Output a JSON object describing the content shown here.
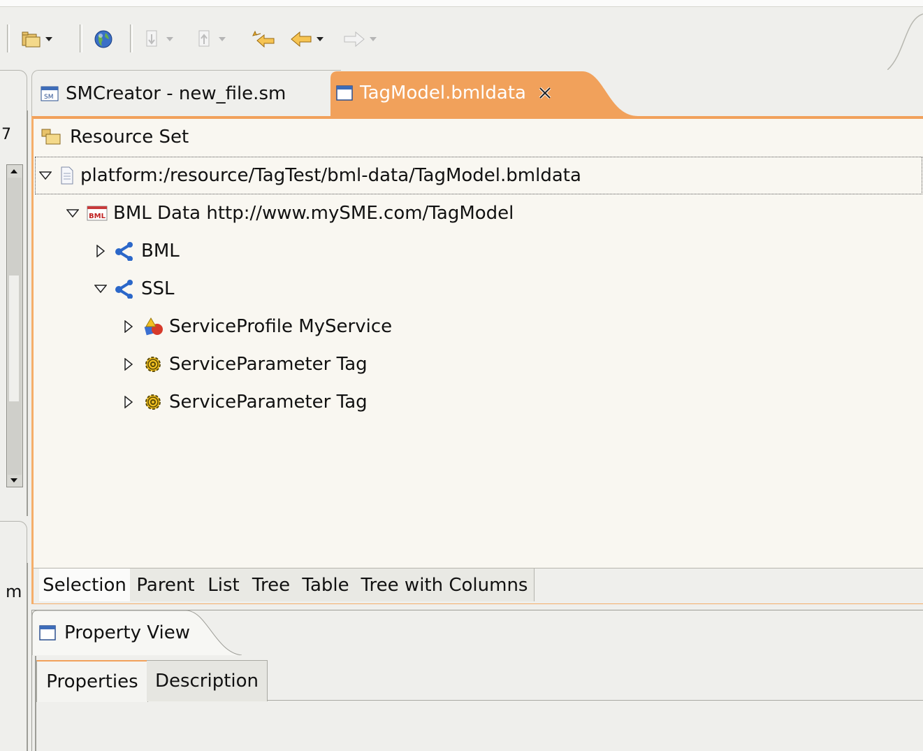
{
  "editor": {
    "tabs": [
      {
        "label": "SMCreator - new_file.sm",
        "icon": "sm-file-icon"
      },
      {
        "label": "TagModel.bmldata",
        "icon": "editor-window-icon",
        "closable": true
      }
    ],
    "active_tab": "TagModel.bmldata",
    "header": "Resource Set",
    "tree": {
      "root": "platform:/resource/TagTest/bml-data/TagModel.bmldata",
      "bml_data": "BML Data http://www.mySME.com/TagModel",
      "bml": "BML",
      "ssl": "SSL",
      "service_profile": "ServiceProfile MyService",
      "service_parameter_1": "ServiceParameter Tag",
      "service_parameter_2": "ServiceParameter Tag"
    },
    "bottom_tabs": [
      "Selection",
      "Parent",
      "List",
      "Tree",
      "Table",
      "Tree with Columns"
    ],
    "bottom_active": "Selection"
  },
  "left_view": {
    "fragment_top": "7",
    "fragment_bottom": "m"
  },
  "property_view": {
    "title": "Property View",
    "tabs": [
      "Properties",
      "Description"
    ],
    "active_tab": "Properties"
  },
  "colors": {
    "active_tab": "#f1a15b",
    "background": "#efefec",
    "editor_bg": "#f9f7f1"
  }
}
